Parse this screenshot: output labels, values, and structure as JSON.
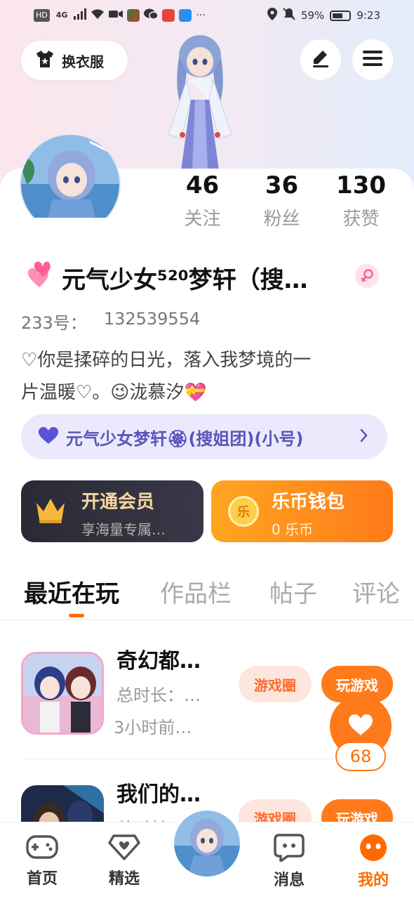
{
  "status_bar": {
    "left_chips": [
      "HD",
      "4G"
    ],
    "battery": "59%",
    "time": "9:23"
  },
  "header": {
    "outfit_label": "换衣服"
  },
  "stats": [
    {
      "num": "46",
      "label": "关注"
    },
    {
      "num": "36",
      "label": "粉丝"
    },
    {
      "num": "130",
      "label": "获赞"
    }
  ],
  "profile": {
    "name": "元气少女⁵²⁰梦轩（搜…",
    "uid_label": "233号：",
    "uid": "132539554",
    "bio_line1": "♡你是揉碎的日光，落入我梦境的一",
    "bio_line2": "片温暖♡。😉泷慕汐💝"
  },
  "group": {
    "label": "元气少女梦轩🏵(搜姐团)(小号)"
  },
  "vip": {
    "title": "开通会员",
    "subtitle": "享海量专属…"
  },
  "wallet": {
    "title": "乐币钱包",
    "subtitle": "0 乐币",
    "coin": "乐"
  },
  "tabs": [
    {
      "label": "最近在玩"
    },
    {
      "label": "作品栏"
    },
    {
      "label": "帖子"
    },
    {
      "label": "评论"
    }
  ],
  "games": [
    {
      "title": "奇幻都…",
      "sub": "总时长：…",
      "time": "3小时前…",
      "circle_btn": "游戏圈",
      "play_btn": "玩游戏"
    },
    {
      "title": "我们的…",
      "sub": "总时长：…",
      "time": "",
      "circle_btn": "游戏圈",
      "play_btn": "玩游戏"
    }
  ],
  "like_count": "68",
  "nav": [
    {
      "label": "首页"
    },
    {
      "label": "精选"
    },
    {
      "label": "消息"
    },
    {
      "label": "我的"
    }
  ],
  "colors": {
    "accent": "#ff6a00",
    "group_pill_bg": "#ebe9fb",
    "group_text": "#5a55b8",
    "vip_bg": "#2a2a35",
    "wallet_bg": "#ff8a1a"
  }
}
